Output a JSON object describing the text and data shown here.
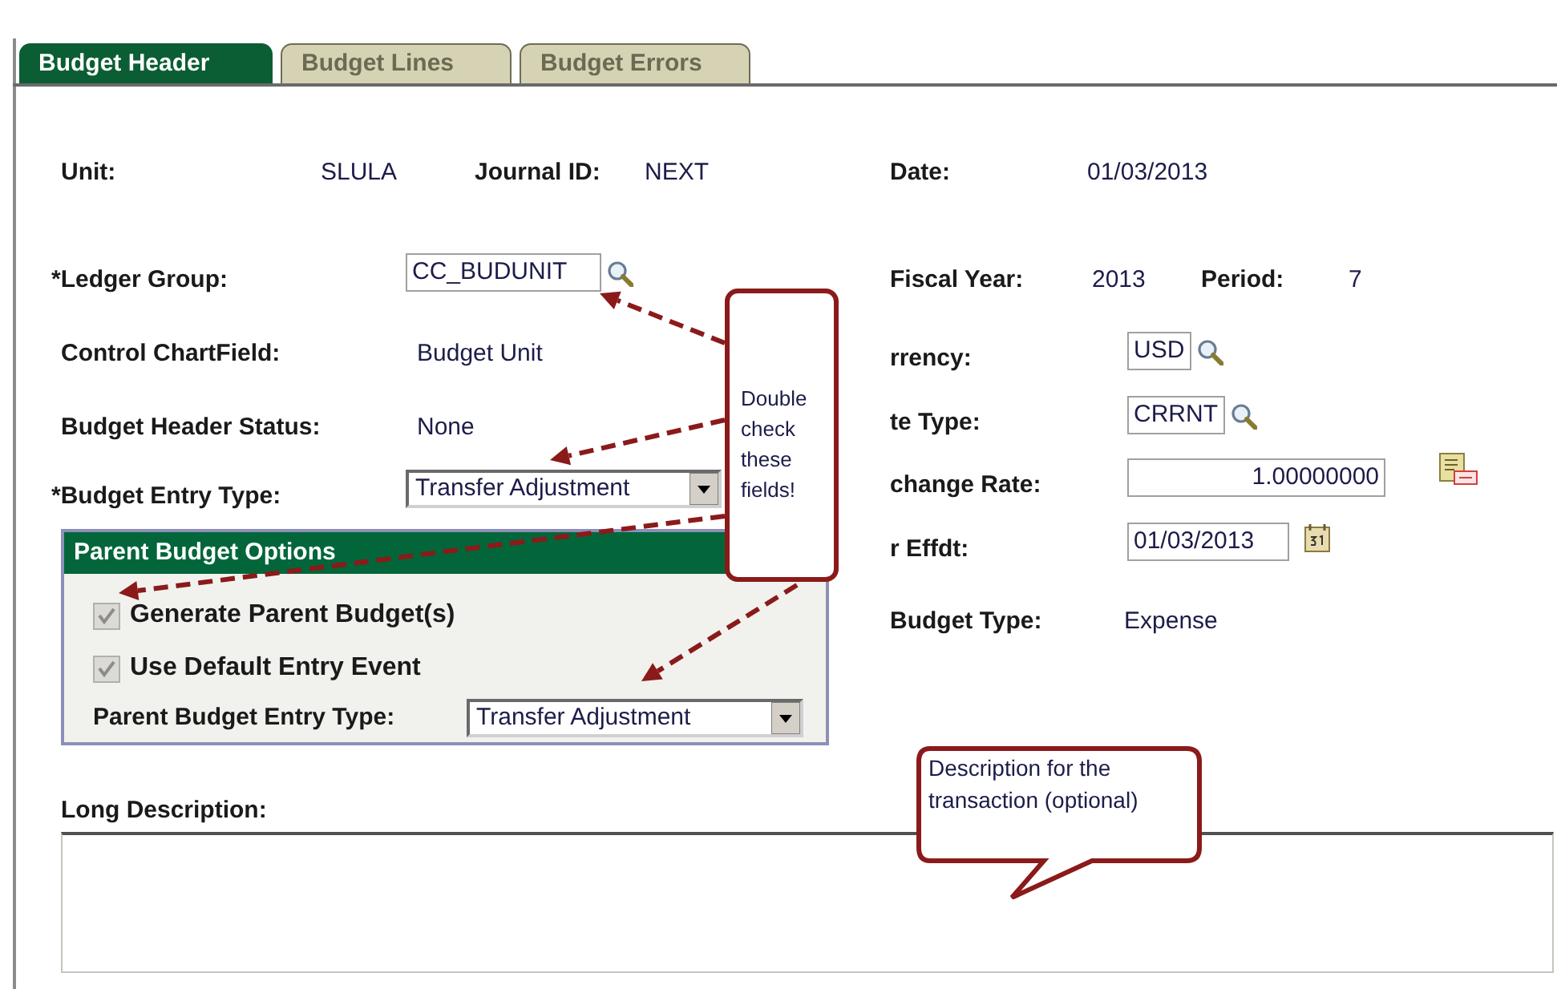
{
  "tabs": [
    {
      "label": "Budget Header",
      "selected": true
    },
    {
      "label": "Budget Lines",
      "selected": false
    },
    {
      "label": "Budget Errors",
      "selected": false
    }
  ],
  "top_row": [
    {
      "label": "Unit:",
      "value": "SLULA"
    },
    {
      "label": "Journal ID:",
      "value": "NEXT"
    }
  ],
  "date": {
    "label": "Date:",
    "value": "01/03/2013"
  },
  "left_fields": [
    {
      "kind": "lookup",
      "label": "*Ledger Group:",
      "value": "CC_BUDUNIT"
    },
    {
      "kind": "text",
      "label": "Control ChartField:",
      "value": "Budget Unit"
    },
    {
      "kind": "text",
      "label": "Budget Header Status:",
      "value": "None"
    },
    {
      "kind": "select",
      "label": "*Budget Entry Type:",
      "value": "Transfer Adjustment"
    }
  ],
  "parent_budget_options": {
    "title": "Parent Budget Options",
    "checkboxes": [
      {
        "label": "Generate Parent Budget(s)",
        "checked": true,
        "disabled": true
      },
      {
        "label": "Use Default Entry Event",
        "checked": true,
        "disabled": true
      }
    ],
    "entry_type": {
      "label": "Parent Budget Entry Type:",
      "value": "Transfer Adjustment"
    }
  },
  "right_fields": [
    {
      "kind": "pair",
      "parts": [
        {
          "label": "Fiscal Year:",
          "value": "2013"
        },
        {
          "label": "Period:",
          "value": "7"
        }
      ]
    },
    {
      "kind": "lookup",
      "label": "rrency:",
      "value": "USD"
    },
    {
      "kind": "lookup",
      "label": "te Type:",
      "value": "CRRNT"
    },
    {
      "kind": "number",
      "label": "change Rate:",
      "value": "1.00000000"
    },
    {
      "kind": "date",
      "label": "r Effdt:",
      "value": "01/03/2013"
    },
    {
      "kind": "text",
      "label": "Budget Type:",
      "value": "Expense"
    }
  ],
  "long_description": {
    "label": "Long Description:"
  },
  "callouts": [
    {
      "kind": "box",
      "text": "Double check these fields!"
    },
    {
      "kind": "bubble",
      "text": "Description for the transaction (optional)"
    }
  ]
}
